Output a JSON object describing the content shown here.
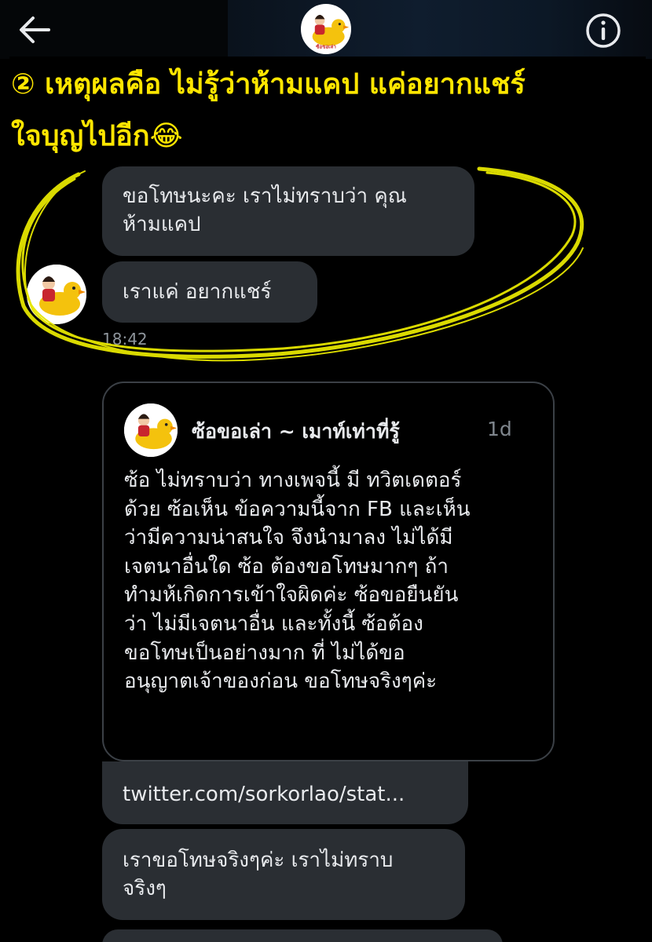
{
  "header": {
    "back_icon": "back-arrow-icon",
    "info_icon": "info-icon",
    "avatar_label": "ซ้อขอเล่า"
  },
  "caption": {
    "line1": "② เหตุผลคือ ไม่รู้ว่าห้ามแคป แค่อยากแชร์",
    "line2": "ใจบุญไปอีก😂",
    "color": "#ffe600"
  },
  "messages": [
    {
      "lines": [
        "ขอโทษนะคะ เราไม่ทราบว่า คุณ",
        "ห้ามแคป"
      ]
    },
    {
      "lines": [
        "เราแค่ อยากแชร์"
      ]
    }
  ],
  "timestamp": "18:42",
  "quote": {
    "author": "ซ้อขอเล่า ~ เมาท์เท่าที่รู้",
    "time": "1d",
    "lines": [
      "ซ้อ ไม่ทราบว่า ทางเพจนี้ มี ทวิตเดตอร์",
      "ด้วย ซ้อเห็น ข้อความนี้จาก FB และเห็น",
      "ว่ามีความน่าสนใจ จึงนำมาลง ไม่ได้มี",
      "เจตนาอื่นใด ซ้อ ต้องขอโทษมากๆ ถ้า",
      "ทำมห้เกิดการเข้าใจผิดค่ะ ซ้อขอยืนยัน",
      "ว่า ไม่มีเจตนาอื่น และทั้งนี้ ซ้อต้อง",
      "ขอโทษเป็นอย่างมาก ที่ ไม่ได้ขอ",
      "อนุญาตเจ้าของก่อน ขอโทษจริงๆค่ะ"
    ]
  },
  "link_message": "twitter.com/sorkorlao/stat...",
  "last_message": {
    "lines": [
      "เราขอโทษจริงๆค่ะ เราไม่ทราบ",
      "จริงๆ"
    ]
  },
  "colors": {
    "bubble": "#2a2e33",
    "highlight_scribble": "#e6e600"
  }
}
